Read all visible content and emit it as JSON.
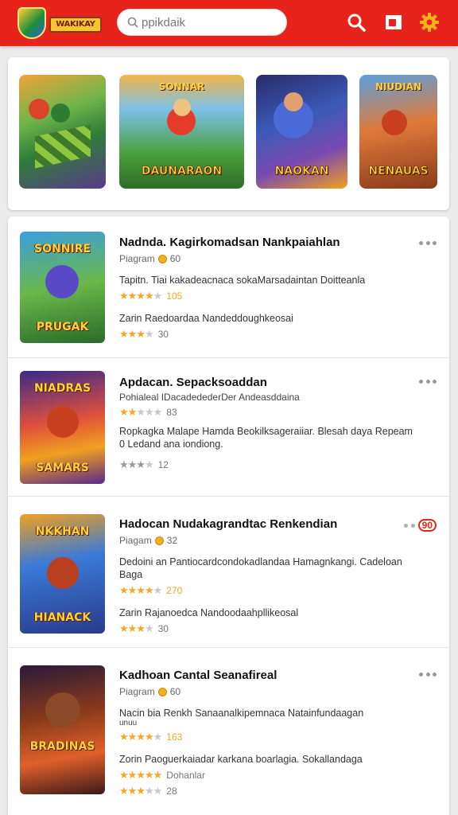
{
  "app": {
    "logo_text": "WAKIKAY",
    "accent": "#e8231c"
  },
  "search": {
    "value": "ppikdaik",
    "placeholder": ""
  },
  "toolbar": {
    "search_icon": "search-icon",
    "tile_icon": "tile-icon",
    "settings_icon": "gear-icon"
  },
  "featured": [
    {
      "title_top": "",
      "title": ""
    },
    {
      "title_top": "SONNAR",
      "title": "DAUNARAON"
    },
    {
      "title_top": "",
      "title": "NAOKAN"
    },
    {
      "title_top": "NIUDIAN",
      "title": "NENAUAS"
    }
  ],
  "items": [
    {
      "thumb_top": "SONNIRE",
      "thumb_bottom": "PRUGAK",
      "title": "Nadnda. Kagirkomadsan Nankpaiahlan",
      "publisher": "Piagram",
      "count": "60",
      "desc1": "Tapitn. Tiai kakadeacnaca sokaMarsadaintan Doitteanla",
      "rating1_stars": "★★★★",
      "rating1_off": "★",
      "rating1_value": "105",
      "desc2": "Zarin Raedoardaa Nandeddoughkeosai",
      "rating2_stars": "★★★",
      "rating2_off": "★",
      "rating2_value": "30"
    },
    {
      "thumb_top": "NIADRAS",
      "thumb_bottom": "SAMARS",
      "title": "Apdacan. Sepacksoaddan",
      "sub": "Pohialeal IDacadedederDer Andeasddaina",
      "rating1_stars": "★★",
      "rating1_off": "★★★",
      "rating1_value": "83",
      "desc1": "Ropkagka Malape Hamda Beokilksageraiiar. Blesah daya Repeam 0 Ledand ana iondiong.",
      "rating2_stars": "★★★",
      "rating2_off": "★",
      "rating2_value": "12"
    },
    {
      "thumb_top": "NKKHAN",
      "thumb_bottom": "HIANACK",
      "title": "Hadocan Nudakagrandtac Renkendian",
      "badge": "90",
      "publisher": "Piagam",
      "count": "32",
      "desc1": "Dedoini an Pantiocardcondokadlandaa Hamagnkangi. Cadeloan Baga",
      "rating1_stars": "★★★★",
      "rating1_off": "★",
      "rating1_value": "270",
      "desc2": "Zarin Rajanoedca Nandoodaahpllikeosal",
      "rating2_stars": "★★★",
      "rating2_off": "★",
      "rating2_value": "30"
    },
    {
      "thumb_top": "",
      "thumb_bottom": "BRADINAS",
      "title": "Kadhoan Cantal Seanafireal",
      "publisher": "Piagram",
      "count": "60",
      "desc1": "Nacin bia Renkh Sanaanalkipemnaca Natainfundaagan",
      "desc1b": "unuu",
      "rating1_stars": "★★★★",
      "rating1_off": "★",
      "rating1_value": "163",
      "desc2": "Zorin Paoguerkaiadar karkana boarlagia. Sokallandaga",
      "rating2_stars": "★★★★★",
      "rating2_off": "",
      "rating2_label": "Dohanlar",
      "rating3_stars": "★★★",
      "rating3_off": "★★",
      "rating3_value": "28"
    }
  ]
}
